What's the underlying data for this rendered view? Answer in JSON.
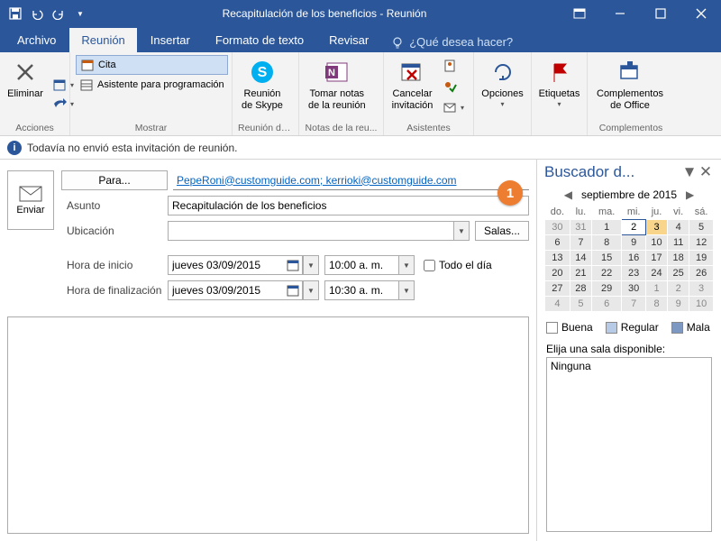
{
  "titlebar": {
    "title": "Recapitulación de los beneficios  -  Reunión"
  },
  "tabs": {
    "archivo": "Archivo",
    "reunion": "Reunión",
    "insertar": "Insertar",
    "formato": "Formato de texto",
    "revisar": "Revisar",
    "tellme": "¿Qué desea hacer?"
  },
  "ribbon": {
    "acciones": {
      "label": "Acciones",
      "eliminar": "Eliminar"
    },
    "mostrar": {
      "label": "Mostrar",
      "cita": "Cita",
      "asistente": "Asistente para programación"
    },
    "skype": {
      "label": "Reunión de...",
      "btn": "Reunión\nde Skype"
    },
    "notas": {
      "label": "Notas de la reu...",
      "btn": "Tomar notas\nde la reunión"
    },
    "asistentes": {
      "label": "Asistentes",
      "cancelar": "Cancelar\ninvitación"
    },
    "opciones": {
      "label": "Opciones"
    },
    "etiquetas": {
      "label": "Etiquetas"
    },
    "complementos": {
      "label": "Complementos",
      "btn": "Complementos\nde Office"
    }
  },
  "infobar": {
    "text": "Todavía no envió esta invitación de reunión."
  },
  "form": {
    "enviar": "Enviar",
    "para_btn": "Para...",
    "para_val": "PepeRoni@customguide.com; kerrioki@customguide.com",
    "asunto_lbl": "Asunto",
    "asunto_val": "Recapitulación de los beneficios",
    "ubicacion_lbl": "Ubicación",
    "ubicacion_val": "",
    "salas_btn": "Salas...",
    "start_lbl": "Hora de inicio",
    "start_date": "jueves 03/09/2015",
    "start_time": "10:00 a. m.",
    "end_lbl": "Hora de finalización",
    "end_date": "jueves 03/09/2015",
    "end_time": "10:30 a. m.",
    "allday": "Todo el día"
  },
  "sidepane": {
    "title": "Buscador d...",
    "month": "septiembre de 2015",
    "dow": [
      "do.",
      "lu.",
      "ma.",
      "mi.",
      "ju.",
      "vi.",
      "sá."
    ],
    "grid": [
      [
        {
          "d": "30"
        },
        {
          "d": "31"
        },
        {
          "d": "1",
          "m": 1
        },
        {
          "d": "2",
          "m": 1,
          "t": 1
        },
        {
          "d": "3",
          "m": 1,
          "s": 1
        },
        {
          "d": "4",
          "m": 1
        },
        {
          "d": "5",
          "m": 1
        }
      ],
      [
        {
          "d": "6",
          "m": 1
        },
        {
          "d": "7",
          "m": 1
        },
        {
          "d": "8",
          "m": 1
        },
        {
          "d": "9",
          "m": 1
        },
        {
          "d": "10",
          "m": 1
        },
        {
          "d": "11",
          "m": 1
        },
        {
          "d": "12",
          "m": 1
        }
      ],
      [
        {
          "d": "13",
          "m": 1
        },
        {
          "d": "14",
          "m": 1
        },
        {
          "d": "15",
          "m": 1
        },
        {
          "d": "16",
          "m": 1
        },
        {
          "d": "17",
          "m": 1
        },
        {
          "d": "18",
          "m": 1
        },
        {
          "d": "19",
          "m": 1
        }
      ],
      [
        {
          "d": "20",
          "m": 1
        },
        {
          "d": "21",
          "m": 1
        },
        {
          "d": "22",
          "m": 1
        },
        {
          "d": "23",
          "m": 1
        },
        {
          "d": "24",
          "m": 1
        },
        {
          "d": "25",
          "m": 1
        },
        {
          "d": "26",
          "m": 1
        }
      ],
      [
        {
          "d": "27",
          "m": 1
        },
        {
          "d": "28",
          "m": 1
        },
        {
          "d": "29",
          "m": 1
        },
        {
          "d": "30",
          "m": 1
        },
        {
          "d": "1"
        },
        {
          "d": "2"
        },
        {
          "d": "3"
        }
      ],
      [
        {
          "d": "4"
        },
        {
          "d": "5"
        },
        {
          "d": "6"
        },
        {
          "d": "7"
        },
        {
          "d": "8"
        },
        {
          "d": "9"
        },
        {
          "d": "10"
        }
      ]
    ],
    "legend": {
      "buena": "Buena",
      "regular": "Regular",
      "mala": "Mala"
    },
    "room_lbl": "Elija una sala disponible:",
    "room_none": "Ninguna"
  },
  "callout": {
    "n": "1"
  }
}
